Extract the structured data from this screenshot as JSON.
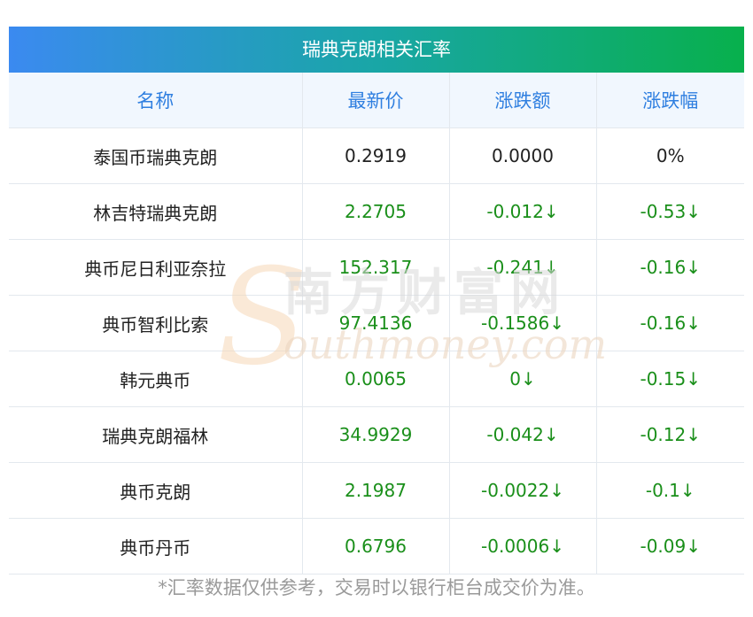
{
  "title": "瑞典克朗相关汇率",
  "headers": [
    "名称",
    "最新价",
    "涨跌额",
    "涨跌幅"
  ],
  "rows": [
    {
      "name": "泰国币瑞典克朗",
      "price": "0.2919",
      "change": "0.0000",
      "pct": "0%",
      "trend": "flat"
    },
    {
      "name": "林吉特瑞典克朗",
      "price": "2.2705",
      "change": "-0.012↓",
      "pct": "-0.53↓",
      "trend": "down"
    },
    {
      "name": "典币尼日利亚奈拉",
      "price": "152.317",
      "change": "-0.241↓",
      "pct": "-0.16↓",
      "trend": "down"
    },
    {
      "name": "典币智利比索",
      "price": "97.4136",
      "change": "-0.1586↓",
      "pct": "-0.16↓",
      "trend": "down"
    },
    {
      "name": "韩元典币",
      "price": "0.0065",
      "change": "0↓",
      "pct": "-0.15↓",
      "trend": "down"
    },
    {
      "name": "瑞典克朗福林",
      "price": "34.9929",
      "change": "-0.042↓",
      "pct": "-0.12↓",
      "trend": "down"
    },
    {
      "name": "典币克朗",
      "price": "2.1987",
      "change": "-0.0022↓",
      "pct": "-0.1↓",
      "trend": "down"
    },
    {
      "name": "典币丹币",
      "price": "0.6796",
      "change": "-0.0006↓",
      "pct": "-0.09↓",
      "trend": "down"
    }
  ],
  "footnote": "*汇率数据仅供参考，交易时以银行柜台成交价为准。",
  "watermark": {
    "cn": "南方财富网",
    "en": "outhmoney.com",
    "logo_letter": "S"
  },
  "colors": {
    "down": "#1a8f1a",
    "header_text": "#2f7fe0",
    "header_bg": "#f1f7fe",
    "title_start": "#3b8af0",
    "title_end": "#08b04c"
  }
}
